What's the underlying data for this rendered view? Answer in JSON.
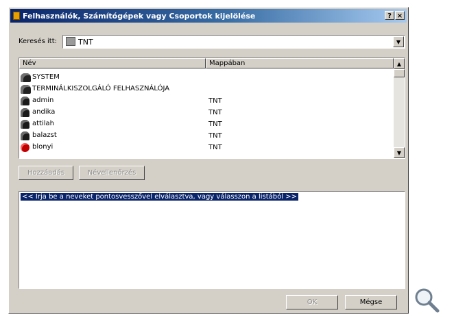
{
  "window": {
    "title": "Felhasználók, Számítógépek vagy Csoportok kijelölése",
    "help_glyph": "?",
    "close_glyph": "×"
  },
  "search": {
    "label": "Keresés itt:",
    "value": "TNT",
    "dropdown_glyph": "▼"
  },
  "list": {
    "columns": [
      "Név",
      "Mappában"
    ],
    "rows": [
      {
        "name": "SYSTEM",
        "folder": "",
        "icon": "group-icon"
      },
      {
        "name": "TERMINÁLKISZOLGÁLÓ FELHASZNÁLÓJA",
        "folder": "",
        "icon": "group-icon"
      },
      {
        "name": "admin",
        "folder": "TNT",
        "icon": "user-icon"
      },
      {
        "name": "andika",
        "folder": "TNT",
        "icon": "user-icon"
      },
      {
        "name": "attilah",
        "folder": "TNT",
        "icon": "user-icon"
      },
      {
        "name": "balazst",
        "folder": "TNT",
        "icon": "user-icon"
      },
      {
        "name": "blonyi",
        "folder": "TNT",
        "icon": "disabled-user-icon"
      }
    ],
    "scroll_up_glyph": "▲",
    "scroll_down_glyph": "▼"
  },
  "buttons": {
    "add": "Hozzáadás",
    "check_names": "Névellenőrzés",
    "ok": "OK",
    "cancel": "Mégse"
  },
  "names_box": {
    "hint": "<< Írja be a neveket pontosvesszővel elválasztva, vagy válasszon a listából >>"
  },
  "icons": {
    "title_icon": "select-users-icon",
    "zoom": "magnifier-icon"
  }
}
